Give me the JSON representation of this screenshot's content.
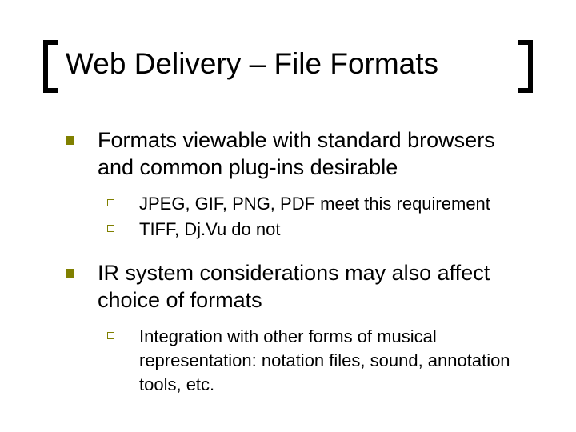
{
  "title": "Web Delivery – File Formats",
  "bullets": [
    {
      "text": "Formats viewable with standard browsers and common plug-ins desirable",
      "sub": [
        "JPEG, GIF, PNG, PDF meet this requirement",
        "TIFF, Dj.Vu do not"
      ]
    },
    {
      "text": "IR system considerations may also affect choice of formats",
      "sub": [
        "Integration with other forms of musical representation: notation files, sound, annotation tools, etc."
      ]
    }
  ]
}
